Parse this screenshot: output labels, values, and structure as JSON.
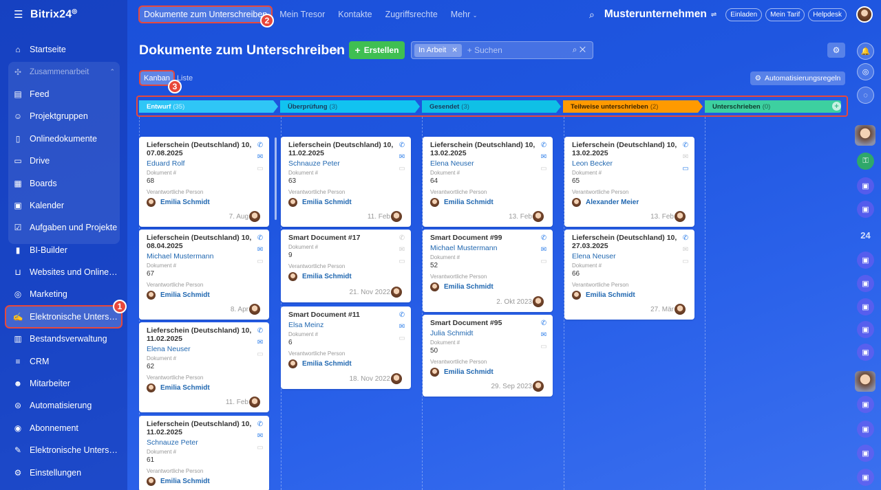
{
  "sidebar": {
    "logo": "Bitrix24",
    "items": [
      {
        "label": "Startseite",
        "icon": "home-icon"
      },
      {
        "label": "Zusammenarbeit",
        "icon": "collab-icon"
      },
      {
        "label": "Feed",
        "icon": "feed-icon"
      },
      {
        "label": "Projektgruppen",
        "icon": "groups-icon"
      },
      {
        "label": "Onlinedokumente",
        "icon": "document-icon"
      },
      {
        "label": "Drive",
        "icon": "drive-icon"
      },
      {
        "label": "Boards",
        "icon": "boards-icon"
      },
      {
        "label": "Kalender",
        "icon": "calendar-icon"
      },
      {
        "label": "Aufgaben und Projekte",
        "icon": "tasks-icon"
      },
      {
        "label": "BI-Builder",
        "icon": "chart-icon"
      },
      {
        "label": "Websites und Onlineshops",
        "icon": "cart-icon"
      },
      {
        "label": "Marketing",
        "icon": "target-icon"
      },
      {
        "label": "Elektronische Unterschrift",
        "icon": "pen-icon"
      },
      {
        "label": "Bestandsverwaltung",
        "icon": "inventory-icon"
      },
      {
        "label": "CRM",
        "icon": "crm-icon"
      },
      {
        "label": "Mitarbeiter",
        "icon": "people-icon"
      },
      {
        "label": "Automatisierung",
        "icon": "automation-icon"
      },
      {
        "label": "Abonnement",
        "icon": "subscription-icon"
      },
      {
        "label": "Elektronische Unterschrift",
        "icon": "sign-icon"
      },
      {
        "label": "Einstellungen",
        "icon": "gear-icon"
      }
    ]
  },
  "topbar": {
    "tabs": [
      "Dokumente zum Unterschreiben",
      "Mein Tresor",
      "Kontakte",
      "Zugriffsrechte",
      "Mehr"
    ],
    "company": "Musterunternehmen",
    "buttons": [
      "Einladen",
      "Mein Tarif",
      "Helpdesk"
    ]
  },
  "badges": [
    "1",
    "2",
    "3"
  ],
  "header": {
    "title": "Dokumente zum Unterschreiben",
    "create": "Erstellen",
    "filter_chip": "In Arbeit",
    "search_placeholder": "+ Suchen",
    "view_tabs": [
      "Kanban",
      "Liste"
    ],
    "automation": "Automatisierungsregeln"
  },
  "stages": [
    {
      "name": "Entwurf",
      "count": "(35)",
      "color": "#2fc6f6",
      "text": "#fff"
    },
    {
      "name": "Überprüfung",
      "count": "(3)",
      "color": "#11c3f0",
      "text": "#1b3a5a"
    },
    {
      "name": "Gesendet",
      "count": "(3)",
      "color": "#0fc0e6",
      "text": "#1b3a5a"
    },
    {
      "name": "Teilweise unterschrieben",
      "count": "(2)",
      "color": "#ff9a00",
      "text": "#3a2400"
    },
    {
      "name": "Unterschrieben",
      "count": "(0)",
      "color": "#3dd0a0",
      "text": "#10382c"
    }
  ],
  "labels": {
    "doc": "Dokument #",
    "resp": "Verantwortliche Person"
  },
  "columns": [
    [
      {
        "title": "Lieferschein (Deutschland) 10, 07.08.2025",
        "client": "Eduard Rolf",
        "num": "68",
        "person": "Emilia Schmidt",
        "date": "7. Aug"
      },
      {
        "title": "Lieferschein (Deutschland) 10, 08.04.2025",
        "client": "Michael Mustermann",
        "num": "67",
        "person": "Emilia Schmidt",
        "date": "8. Apr"
      },
      {
        "title": "Lieferschein (Deutschland) 10, 11.02.2025",
        "client": "Elena Neuser",
        "num": "62",
        "person": "Emilia Schmidt",
        "date": "11. Feb"
      },
      {
        "title": "Lieferschein (Deutschland) 10, 11.02.2025",
        "client": "Schnauze Peter",
        "num": "61",
        "person": "Emilia Schmidt",
        "date": ""
      }
    ],
    [
      {
        "title": "Lieferschein (Deutschland) 10, 11.02.2025",
        "client": "Schnauze Peter",
        "num": "63",
        "person": "Emilia Schmidt",
        "date": "11. Feb"
      },
      {
        "title": "Smart Document #17",
        "client": "",
        "num": "9",
        "person": "Emilia Schmidt",
        "date": "21. Nov 2022"
      },
      {
        "title": "Smart Document #11",
        "client": "Elsa Meinz",
        "num": "6",
        "person": "Emilia Schmidt",
        "date": "18. Nov 2022"
      }
    ],
    [
      {
        "title": "Lieferschein (Deutschland) 10, 13.02.2025",
        "client": "Elena Neuser",
        "num": "64",
        "person": "Emilia Schmidt",
        "date": "13. Feb"
      },
      {
        "title": "Smart Document #99",
        "client": "Michael Mustermann",
        "num": "52",
        "person": "Emilia Schmidt",
        "date": "2. Okt 2023"
      },
      {
        "title": "Smart Document #95",
        "client": "Julia Schmidt",
        "num": "50",
        "person": "Emilia Schmidt",
        "date": "29. Sep 2023"
      }
    ],
    [
      {
        "title": "Lieferschein (Deutschland) 10, 13.02.2025",
        "client": "Leon Becker",
        "num": "65",
        "person": "Alexander Meier",
        "date": "13. Feb"
      },
      {
        "title": "Lieferschein (Deutschland) 10, 27.03.2025",
        "client": "Elena Neuser",
        "num": "66",
        "person": "Emilia Schmidt",
        "date": "27. Mär"
      }
    ]
  ],
  "rail": [
    "bell-icon",
    "target-icon",
    "chat-icon",
    "user-avatar",
    "lock-icon",
    "app-icon",
    "app-icon",
    "24-icon",
    "app-icon",
    "app-icon",
    "app-icon",
    "app-icon",
    "app-icon",
    "user-avatar",
    "app-icon",
    "app-icon",
    "app-icon",
    "app-icon"
  ],
  "rail_text": {
    "b24": "24"
  }
}
